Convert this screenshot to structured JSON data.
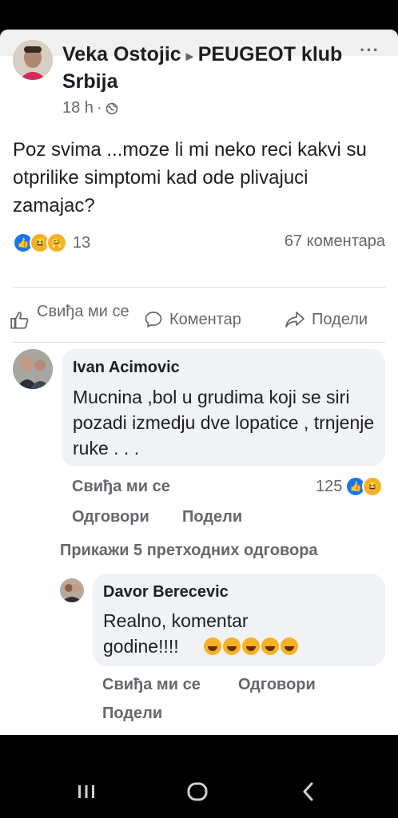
{
  "post": {
    "author": "Veka Ostojic",
    "arrow": "▸",
    "group": "PEUGEOT klub Srbija",
    "time": "18 h",
    "separator": "·",
    "text": "Poz svima ...moze li mi neko reci kakvi su otprilike simptomi kad ode plivajuci zamajac?",
    "more_menu": "···",
    "reaction_count": "13",
    "comment_count": "67 коментара"
  },
  "actions": {
    "like": "Свиђа ми се",
    "comment": "Коментар",
    "share": "Подели"
  },
  "comments": [
    {
      "name": "Ivan Acimovic",
      "text": "Mucnina ,bol u grudima koji se siri pozadi izmedju dve lopatice , trnjenje ruke  . . .",
      "like": "Свиђа ми се",
      "reply": "Одговори",
      "share": "Подели",
      "reaction_count": "125"
    }
  ],
  "show_previous": "Прикажи 5 претходних одговора",
  "reply": {
    "name": "Davor Berecevic",
    "text": "Realno, komentar godine!!!!",
    "like": "Свиђа ми се",
    "reply": "Одговори",
    "share": "Подели"
  },
  "icons": [
    "globe-icon",
    "like-icon",
    "comment-icon",
    "share-icon",
    "recents-icon",
    "home-icon",
    "back-icon"
  ],
  "colors": {
    "facebook_blue": "#1877f2",
    "text": "#1c1e21",
    "secondary": "#65676b",
    "bubble": "#f0f2f5"
  }
}
